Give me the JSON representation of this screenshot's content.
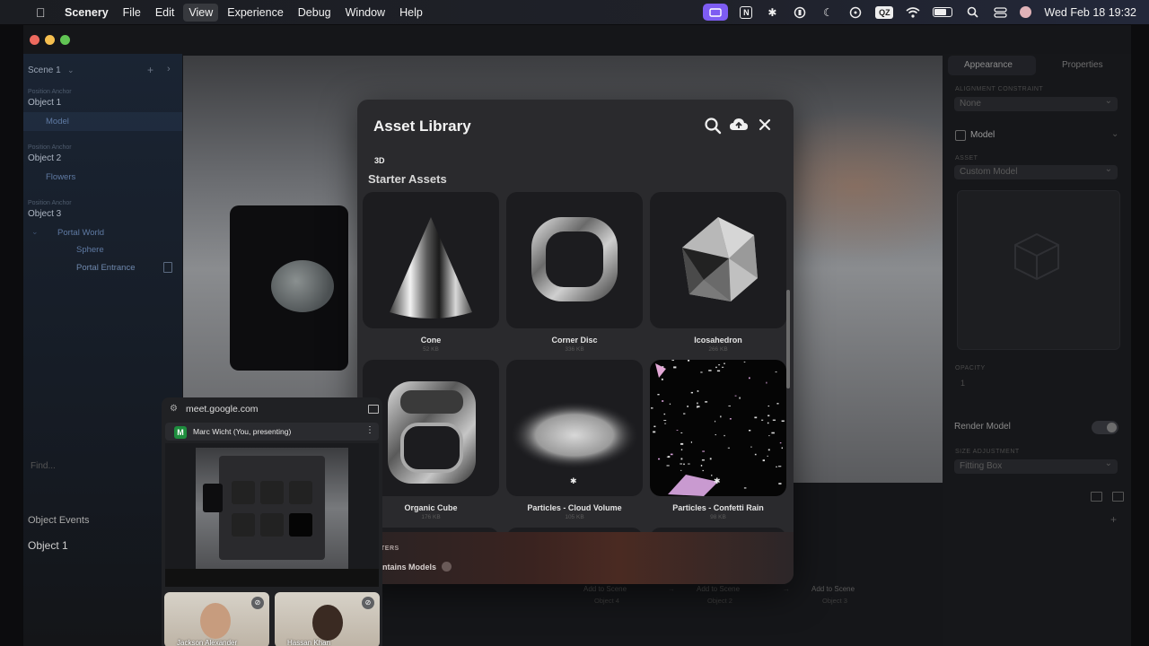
{
  "menubar": {
    "app_name": "Scenery",
    "items": [
      "File",
      "Edit",
      "View",
      "Experience",
      "Debug",
      "Window",
      "Help"
    ],
    "active_item": "View",
    "icon_n": "N",
    "icon_qz": "QZ",
    "clock": "Wed Feb 18  19:32"
  },
  "sidebar": {
    "scene_label": "Scene 1",
    "anchor_label": "Position Anchor",
    "objects": [
      {
        "name": "Object 1",
        "children": [
          "Model"
        ]
      },
      {
        "name": "Object 2",
        "children": [
          "Flowers"
        ]
      },
      {
        "name": "Object 3",
        "children": [
          "Portal World",
          "Sphere",
          "Portal Entrance"
        ]
      }
    ],
    "search_placeholder": "Find...",
    "events_label": "Object Events",
    "events_object": "Object 1"
  },
  "inspector": {
    "tabs": [
      "Appearance",
      "Properties"
    ],
    "alignment_label": "ALIGNMENT CONSTRAINT",
    "alignment_value": "None",
    "model_section": "Model",
    "asset_label": "ASSET",
    "asset_value": "Custom Model",
    "opacity_label": "OPACITY",
    "opacity_value": "1",
    "render_model_label": "Render Model",
    "size_label": "SIZE ADJUSTMENT",
    "size_value": "Fitting Box"
  },
  "timeline": [
    {
      "label": "Add to Scene",
      "sub": "Object 4"
    },
    {
      "label": "Add to Scene",
      "sub": "Object 2"
    },
    {
      "label": "Add to Scene",
      "sub": "Object 3"
    }
  ],
  "asset_library": {
    "title": "Asset Library",
    "active_tab": "3D",
    "section_title": "Starter Assets",
    "assets": [
      {
        "name": "Cone",
        "size": "52 KB"
      },
      {
        "name": "Corner Disc",
        "size": "336 KB"
      },
      {
        "name": "Icosahedron",
        "size": "266 KB"
      },
      {
        "name": "Organic Cube",
        "size": "176 KB"
      },
      {
        "name": "Particles - Cloud Volume",
        "size": "105 KB"
      },
      {
        "name": "Particles - Confetti Rain",
        "size": "98 KB"
      }
    ],
    "filter_heading": "TERS",
    "filter_contains": "ntains Models"
  },
  "meet": {
    "url": "meet.google.com",
    "presenter_initial": "M",
    "presenter_label": "Marc Wicht (You, presenting)",
    "participants": [
      "Jackson Alexander",
      "Hassan Khan"
    ]
  },
  "colors": {
    "accent_purple": "#7d5cf2",
    "meet_green": "#1e8e3e",
    "traffic_red": "#ed6a5e",
    "traffic_yellow": "#f5bf4f",
    "traffic_green": "#61c554"
  }
}
